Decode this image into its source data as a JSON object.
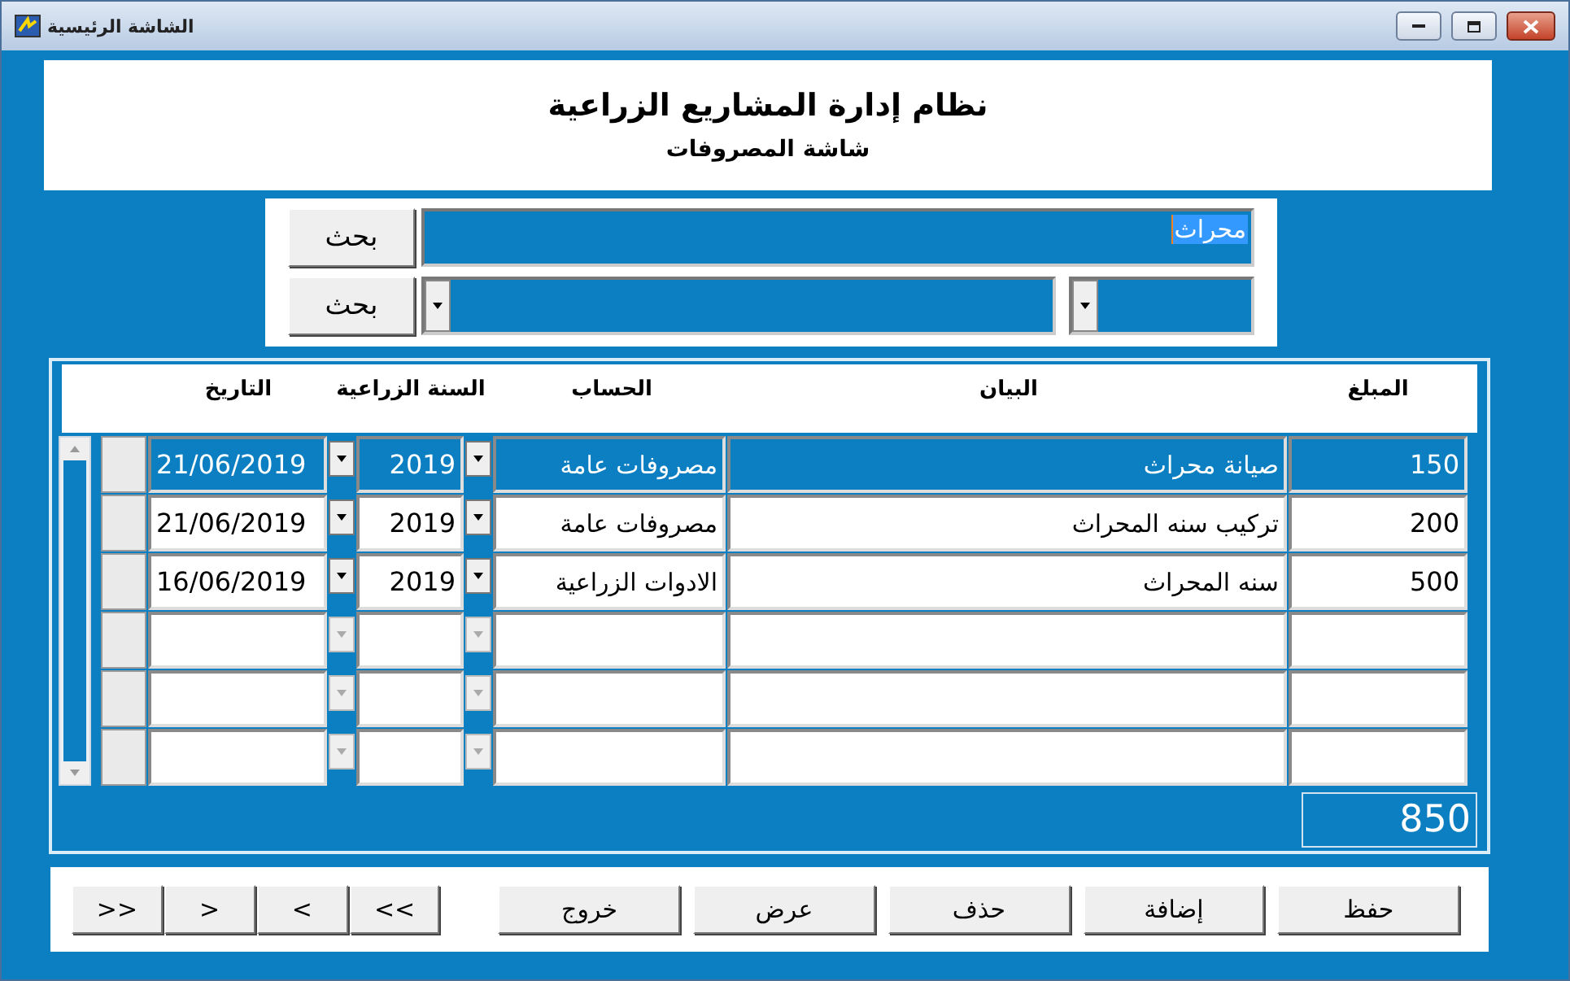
{
  "window": {
    "title": "الشاشة الرئيسية"
  },
  "header": {
    "title": "نظام إدارة المشاريع الزراعية",
    "subtitle": "شاشة المصروفات"
  },
  "search": {
    "text_value": "محراث",
    "text_button": "بحث",
    "combo_button": "بحث"
  },
  "table": {
    "columns": [
      "المبلغ",
      "البيان",
      "الحساب",
      "السنة الزراعية",
      "التاريخ"
    ],
    "rows": [
      {
        "kind": "data",
        "selected": true,
        "amount": "150",
        "description": "صيانة محراث",
        "account": "مصروفات عامة",
        "year": "2019",
        "date": "21/06/2019"
      },
      {
        "kind": "data",
        "selected": false,
        "amount": "200",
        "description": "تركيب سنه المحراث",
        "account": "مصروفات عامة",
        "year": "2019",
        "date": "21/06/2019"
      },
      {
        "kind": "data",
        "selected": false,
        "amount": "500",
        "description": "سنه المحراث",
        "account": "الادوات الزراعية",
        "year": "2019",
        "date": "16/06/2019"
      },
      {
        "kind": "blank",
        "selected": false
      },
      {
        "kind": "blank",
        "selected": false
      },
      {
        "kind": "blank",
        "selected": false
      }
    ],
    "total": "850"
  },
  "actions": [
    "حفظ",
    "إضافة",
    "حذف",
    "عرض",
    "خروج"
  ],
  "navigation": [
    "<<",
    "<",
    ">",
    ">>"
  ]
}
